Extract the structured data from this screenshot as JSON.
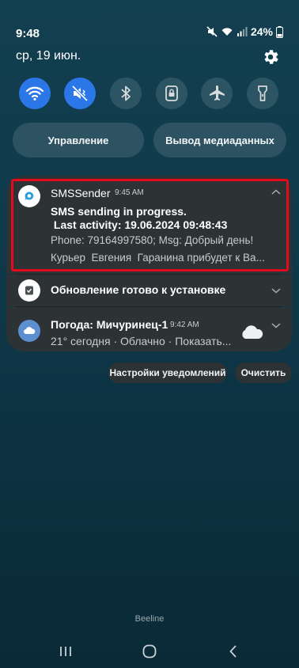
{
  "status_bar": {
    "time": "9:48",
    "battery": "24%",
    "icons": [
      "mute-icon",
      "wifi-icon",
      "signal-icon",
      "battery-icon"
    ]
  },
  "date": "ср, 19 июн.",
  "quick_settings": [
    {
      "name": "wifi",
      "icon": "wifi-icon",
      "state": "on"
    },
    {
      "name": "sound",
      "icon": "mute-icon",
      "state": "on"
    },
    {
      "name": "bluetooth",
      "icon": "bluetooth-icon",
      "state": "off"
    },
    {
      "name": "rotation-lock",
      "icon": "lock-icon",
      "state": "off"
    },
    {
      "name": "airplane",
      "icon": "airplane-icon",
      "state": "off"
    },
    {
      "name": "flashlight",
      "icon": "flashlight-icon",
      "state": "off"
    }
  ],
  "pills": {
    "control": "Управление",
    "media_output": "Вывод медиаданных"
  },
  "notifications": {
    "sms": {
      "app": "SMSSender",
      "time": "9:45 AM",
      "title_line1": "SMS sending in progress.",
      "title_line2": " Last activity: 19.06.2024 09:48:43",
      "line3": "Phone: 79164997580; Msg: Добрый день!",
      "line4": "Курьер  Евгения  Гаранина прибудет к Ва..."
    },
    "update": {
      "title": "Обновление готово к установке"
    },
    "weather": {
      "title": "Погода: Мичуринец-1",
      "time": "9:42 AM",
      "text": "21° сегодня · Облачно · Показать..."
    }
  },
  "actions": {
    "notification_settings": "Настройки уведомлений",
    "clear": "Очистить"
  },
  "carrier": "Beeline",
  "colors": {
    "accent": "#2c77e7",
    "card": "#2d3234",
    "highlight": "#e10b1b"
  }
}
